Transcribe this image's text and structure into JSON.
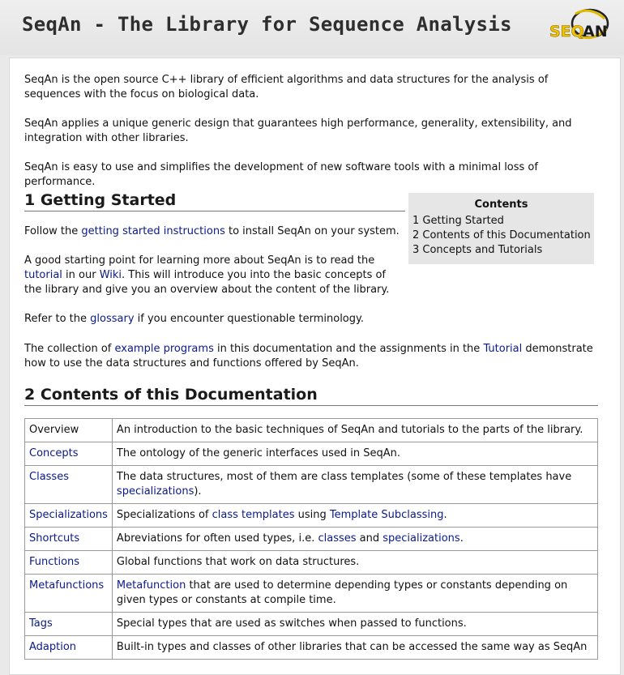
{
  "header": {
    "title": "SeqAn - The Library for Sequence Analysis",
    "logo_text": "SEQAN"
  },
  "intro": [
    "SeqAn is the open source C++ library of efficient algorithms and data structures for the analysis of sequences with the focus on biological data.",
    "SeqAn applies a unique generic design that guarantees high performance, generality, extensibility, and integration with other libraries.",
    "SeqAn is easy to use and simplifies the development of new software tools with a minimal loss of performance."
  ],
  "toc": {
    "title": "Contents",
    "items": [
      "1 Getting Started",
      "2 Contents of this Documentation",
      "3 Concepts and Tutorials"
    ]
  },
  "getting_started": {
    "heading": "1 Getting Started",
    "p1_pre": "Follow the ",
    "p1_link": "getting started instructions",
    "p1_post": " to install SeqAn on your system.",
    "p2_pre": "A good starting point for learning more about SeqAn is to read the ",
    "p2_link1": "tutorial",
    "p2_mid": " in our ",
    "p2_link2": "Wiki",
    "p2_post": ". This will introduce you into the basic concepts of the library and give you an overview about the content of the library.",
    "p3_pre": "Refer to the ",
    "p3_link": "glossary",
    "p3_post": " if you encounter questionable terminology.",
    "p4_pre": "The collection of ",
    "p4_link1": "example programs",
    "p4_mid": " in this documentation and the assignments in the ",
    "p4_link2": "Tutorial",
    "p4_post": " demonstrate how to use the data structures and functions offered by SeqAn."
  },
  "contents": {
    "heading": "2 Contents of this Documentation",
    "rows": [
      {
        "name": "Overview",
        "desc_pre": "An introduction to the basic techniques of SeqAn and tutorials to the parts of the library."
      },
      {
        "name": "Concepts",
        "desc_pre": "The ontology of the generic interfaces used in SeqAn."
      },
      {
        "name": "Classes",
        "desc_pre": "The data structures, most of them are class templates (some of these templates have ",
        "desc_link1": "specializations",
        "desc_post": ")."
      },
      {
        "name": "Specializations",
        "desc_pre": "Specializations of ",
        "desc_link1": "class templates",
        "desc_mid": " using ",
        "desc_link2": "Template Subclassing",
        "desc_post": "."
      },
      {
        "name": "Shortcuts",
        "desc_pre": "Abreviations for often used types, i.e. ",
        "desc_link1": "classes",
        "desc_mid": " and ",
        "desc_link2": "specializations",
        "desc_post": "."
      },
      {
        "name": "Functions",
        "desc_pre": "Global functions that work on data structures."
      },
      {
        "name": "Metafunctions",
        "desc_link1": "Metafunction",
        "desc_post": " that are used to determine depending types or constants depending on given types or constants at compile time."
      },
      {
        "name": "Tags",
        "desc_pre": "Special types that are used as switches when passed to functions."
      },
      {
        "name": "Adaption",
        "desc_pre": "Built-in types and classes of other libraries that can be accessed the same way as SeqAn"
      }
    ]
  }
}
